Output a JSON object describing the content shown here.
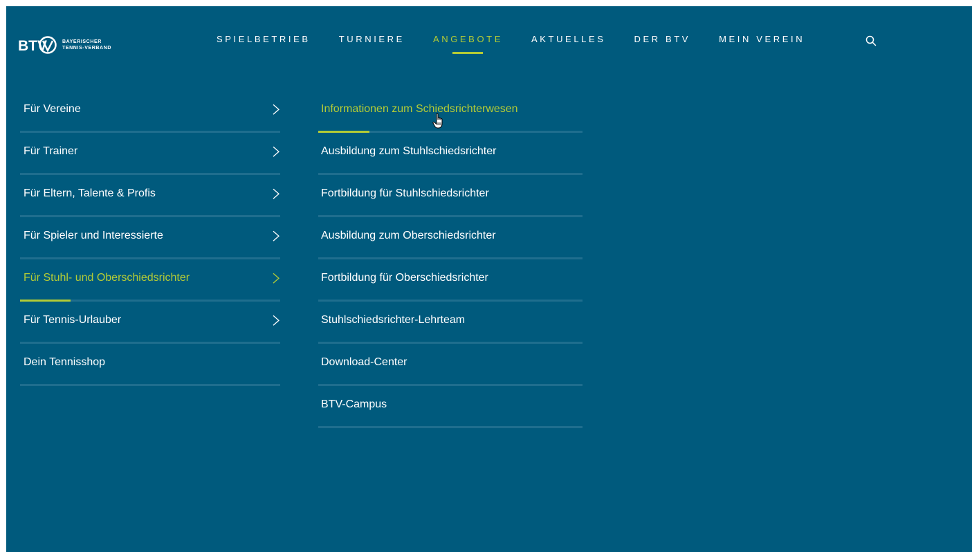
{
  "colors": {
    "background": "#005a7d",
    "accent": "#b3cc35",
    "text": "#ffffff",
    "divider": "#1f6e8e"
  },
  "logo": {
    "letters": "BTV",
    "line1": "BAYERISCHER",
    "line2": "TENNIS-VERBAND"
  },
  "nav": {
    "items": [
      {
        "label": "SPIELBETRIEB",
        "active": false
      },
      {
        "label": "TURNIERE",
        "active": false
      },
      {
        "label": "ANGEBOTE",
        "active": true
      },
      {
        "label": "AKTUELLES",
        "active": false
      },
      {
        "label": "DER BTV",
        "active": false
      },
      {
        "label": "MEIN VEREIN",
        "active": false
      }
    ],
    "search_icon": "search-icon"
  },
  "left_menu": {
    "items": [
      {
        "label": "Für Vereine",
        "has_chevron": true,
        "active": false
      },
      {
        "label": "Für Trainer",
        "has_chevron": true,
        "active": false
      },
      {
        "label": "Für Eltern, Talente & Profis",
        "has_chevron": true,
        "active": false
      },
      {
        "label": "Für Spieler und Interessierte",
        "has_chevron": true,
        "active": false
      },
      {
        "label": "Für Stuhl- und Oberschiedsrichter",
        "has_chevron": true,
        "active": true
      },
      {
        "label": "Für Tennis-Urlauber",
        "has_chevron": true,
        "active": false
      },
      {
        "label": "Dein Tennisshop",
        "has_chevron": false,
        "active": false
      }
    ]
  },
  "sub_menu": {
    "items": [
      {
        "label": "Informationen zum Schiedsrichterwesen",
        "active": true
      },
      {
        "label": "Ausbildung zum Stuhlschiedsrichter",
        "active": false
      },
      {
        "label": "Fortbildung für Stuhlschiedsrichter",
        "active": false
      },
      {
        "label": "Ausbildung zum Oberschiedsrichter",
        "active": false
      },
      {
        "label": "Fortbildung für Oberschiedsrichter",
        "active": false
      },
      {
        "label": "Stuhlschiedsrichter-Lehrteam",
        "active": false
      },
      {
        "label": "Download-Center",
        "active": false
      },
      {
        "label": "BTV-Campus",
        "active": false
      }
    ]
  }
}
